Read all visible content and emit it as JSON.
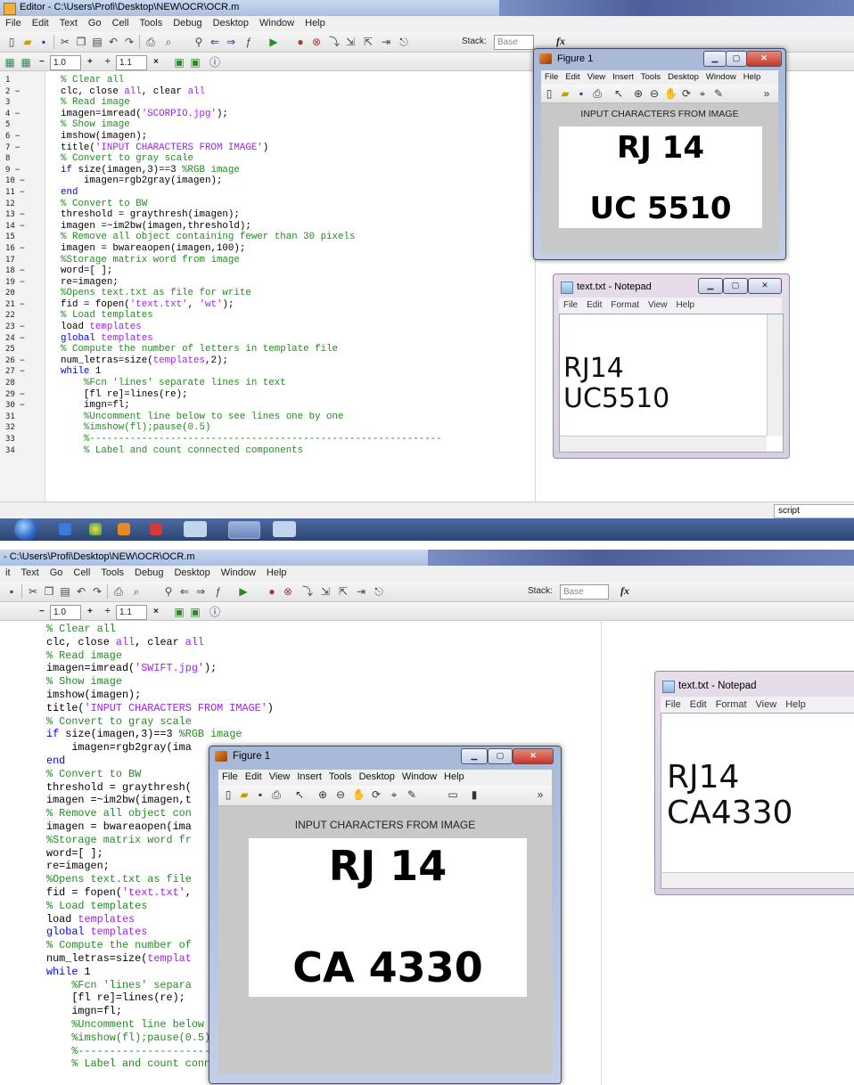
{
  "shot1": {
    "window_title": "Editor - C:\\Users\\Profi\\Desktop\\NEW\\OCR\\OCR.m",
    "menu": [
      "File",
      "Edit",
      "Text",
      "Go",
      "Cell",
      "Tools",
      "Debug",
      "Desktop",
      "Window",
      "Help"
    ],
    "toolbar": {
      "stack_label": "Stack:",
      "stack_value": "Base",
      "fx": "fx"
    },
    "cell_toolbar": {
      "minus": "−",
      "val1": "1.0",
      "plus": "+",
      "div": "÷",
      "val2": "1.1",
      "times": "×"
    },
    "line_numbers": [
      "1",
      "2 −",
      "3",
      "4 −",
      "5",
      "6 −",
      "7 −",
      "8",
      "9 −",
      "10 −",
      "11 −",
      "12",
      "13 −",
      "14 −",
      "15",
      "16 −",
      "17",
      "18 −",
      "19 −",
      "20",
      "21 −",
      "22",
      "23 −",
      "24 −",
      "25",
      "26 −",
      "27 −",
      "28",
      "29 −",
      "30 −",
      "31",
      "32",
      "33",
      "34"
    ],
    "status_script": "script",
    "figure": {
      "title": "Figure 1",
      "menu": [
        "File",
        "Edit",
        "View",
        "Insert",
        "Tools",
        "Desktop",
        "Window",
        "Help"
      ],
      "caption": "INPUT CHARACTERS FROM IMAGE",
      "plate_line1": "RJ 14",
      "plate_line2": "UC 5510"
    },
    "notepad": {
      "title": "text.txt - Notepad",
      "menu": [
        "File",
        "Edit",
        "Format",
        "View",
        "Help"
      ],
      "line1": "RJ14",
      "line2": "UC5510"
    }
  },
  "shot2": {
    "window_title": "- C:\\Users\\Profi\\Desktop\\NEW\\OCR\\OCR.m",
    "menu": [
      "it",
      "Text",
      "Go",
      "Cell",
      "Tools",
      "Debug",
      "Desktop",
      "Window",
      "Help"
    ],
    "toolbar": {
      "stack_label": "Stack:",
      "stack_value": "Base",
      "fx": "fx"
    },
    "cell_toolbar": {
      "minus": "−",
      "val1": "1.0",
      "plus": "+",
      "div": "÷",
      "val2": "1.1",
      "times": "×"
    },
    "figure": {
      "title": "Figure 1",
      "menu": [
        "File",
        "Edit",
        "View",
        "Insert",
        "Tools",
        "Desktop",
        "Window",
        "Help"
      ],
      "caption": "INPUT CHARACTERS FROM IMAGE",
      "plate_line1": "RJ 14",
      "plate_line2": "CA 4330"
    },
    "notepad": {
      "title": "text.txt - Notepad",
      "menu": [
        "File",
        "Edit",
        "Format",
        "View",
        "Help"
      ],
      "line1": "RJ14",
      "line2": "CA4330"
    }
  },
  "code_shot1": [
    [
      {
        "t": "% Clear all",
        "c": "com"
      }
    ],
    [
      {
        "t": "clc, close ",
        "c": ""
      },
      {
        "t": "all",
        "c": "str"
      },
      {
        "t": ", clear ",
        "c": ""
      },
      {
        "t": "all",
        "c": "str"
      }
    ],
    [
      {
        "t": "% Read image",
        "c": "com"
      }
    ],
    [
      {
        "t": "imagen=imread(",
        "c": ""
      },
      {
        "t": "'SCORPIO.jpg'",
        "c": "str"
      },
      {
        "t": ");",
        "c": ""
      }
    ],
    [
      {
        "t": "% Show image",
        "c": "com"
      }
    ],
    [
      {
        "t": "imshow(imagen);",
        "c": ""
      }
    ],
    [
      {
        "t": "title(",
        "c": ""
      },
      {
        "t": "'INPUT CHARACTERS FROM IMAGE'",
        "c": "str"
      },
      {
        "t": ")",
        "c": ""
      }
    ],
    [
      {
        "t": "% Convert to gray scale",
        "c": "com"
      }
    ],
    [
      {
        "t": "if",
        "c": "kw"
      },
      {
        "t": " size(imagen,3)==3 ",
        "c": ""
      },
      {
        "t": "%RGB image",
        "c": "com"
      }
    ],
    [
      {
        "t": "    imagen=rgb2gray(imagen);",
        "c": ""
      }
    ],
    [
      {
        "t": "end",
        "c": "kw"
      }
    ],
    [
      {
        "t": "% Convert to BW",
        "c": "com"
      }
    ],
    [
      {
        "t": "threshold = graythresh(imagen);",
        "c": ""
      }
    ],
    [
      {
        "t": "imagen =~im2bw(imagen,threshold);",
        "c": ""
      }
    ],
    [
      {
        "t": "% Remove all object containing fewer than 30 pixels",
        "c": "com"
      }
    ],
    [
      {
        "t": "imagen = bwareaopen(imagen,100);",
        "c": ""
      }
    ],
    [
      {
        "t": "%Storage matrix word from image",
        "c": "com"
      }
    ],
    [
      {
        "t": "word=[ ];",
        "c": ""
      }
    ],
    [
      {
        "t": "re=imagen;",
        "c": ""
      }
    ],
    [
      {
        "t": "%Opens text.txt as file for write",
        "c": "com"
      }
    ],
    [
      {
        "t": "fid = fopen(",
        "c": ""
      },
      {
        "t": "'text.txt'",
        "c": "str"
      },
      {
        "t": ", ",
        "c": ""
      },
      {
        "t": "'wt'",
        "c": "str"
      },
      {
        "t": ");",
        "c": ""
      }
    ],
    [
      {
        "t": "% Load templates",
        "c": "com"
      }
    ],
    [
      {
        "t": "load ",
        "c": ""
      },
      {
        "t": "templates",
        "c": "str"
      }
    ],
    [
      {
        "t": "global",
        "c": "kw"
      },
      {
        "t": " templates",
        "c": "str"
      }
    ],
    [
      {
        "t": "% Compute the number of letters in template file",
        "c": "com"
      }
    ],
    [
      {
        "t": "num_letras=size(",
        "c": ""
      },
      {
        "t": "templates",
        "c": "str"
      },
      {
        "t": ",2);",
        "c": ""
      }
    ],
    [
      {
        "t": "while",
        "c": "kw"
      },
      {
        "t": " 1",
        "c": ""
      }
    ],
    [
      {
        "t": "    %Fcn 'lines' separate lines in text",
        "c": "com"
      }
    ],
    [
      {
        "t": "    [fl re]=lines(re);",
        "c": ""
      }
    ],
    [
      {
        "t": "    imgn=fl;",
        "c": ""
      }
    ],
    [
      {
        "t": "    %Uncomment line below to see lines one by one",
        "c": "com"
      }
    ],
    [
      {
        "t": "    %imshow(fl);pause(0.5)",
        "c": "com"
      }
    ],
    [
      {
        "t": "    %-------------------------------------------------------------",
        "c": "com"
      }
    ],
    [
      {
        "t": "    % Label and count connected components",
        "c": "com"
      }
    ]
  ],
  "code_shot2": [
    [
      {
        "t": "% Clear all",
        "c": "com"
      }
    ],
    [
      {
        "t": "clc, close ",
        "c": ""
      },
      {
        "t": "all",
        "c": "str"
      },
      {
        "t": ", clear ",
        "c": ""
      },
      {
        "t": "all",
        "c": "str"
      }
    ],
    [
      {
        "t": "% Read image",
        "c": "com"
      }
    ],
    [
      {
        "t": "imagen=imread(",
        "c": ""
      },
      {
        "t": "'SWIFT.jpg'",
        "c": "str"
      },
      {
        "t": ");",
        "c": ""
      }
    ],
    [
      {
        "t": "% Show image",
        "c": "com"
      }
    ],
    [
      {
        "t": "imshow(imagen);",
        "c": ""
      }
    ],
    [
      {
        "t": "title(",
        "c": ""
      },
      {
        "t": "'INPUT CHARACTERS FROM IMAGE'",
        "c": "str"
      },
      {
        "t": ")",
        "c": ""
      }
    ],
    [
      {
        "t": "% Convert to gray scale",
        "c": "com"
      }
    ],
    [
      {
        "t": "if",
        "c": "kw"
      },
      {
        "t": " size(imagen,3)==3 ",
        "c": ""
      },
      {
        "t": "%RGB image",
        "c": "com"
      }
    ],
    [
      {
        "t": "    imagen=rgb2gray(ima",
        "c": ""
      }
    ],
    [
      {
        "t": "end",
        "c": "kw"
      }
    ],
    [
      {
        "t": "% Convert to BW",
        "c": "com"
      }
    ],
    [
      {
        "t": "threshold = graythresh(",
        "c": ""
      }
    ],
    [
      {
        "t": "imagen =~im2bw(imagen,t",
        "c": ""
      }
    ],
    [
      {
        "t": "% Remove all object con",
        "c": "com"
      }
    ],
    [
      {
        "t": "imagen = bwareaopen(ima",
        "c": ""
      }
    ],
    [
      {
        "t": "%Storage matrix word fr",
        "c": "com"
      }
    ],
    [
      {
        "t": "word=[ ];",
        "c": ""
      }
    ],
    [
      {
        "t": "re=imagen;",
        "c": ""
      }
    ],
    [
      {
        "t": "%Opens text.txt as file",
        "c": "com"
      }
    ],
    [
      {
        "t": "fid = fopen(",
        "c": ""
      },
      {
        "t": "'text.txt'",
        "c": "str"
      },
      {
        "t": ",",
        "c": ""
      }
    ],
    [
      {
        "t": "% Load templates",
        "c": "com"
      }
    ],
    [
      {
        "t": "load ",
        "c": ""
      },
      {
        "t": "templates",
        "c": "str"
      }
    ],
    [
      {
        "t": "global",
        "c": "kw"
      },
      {
        "t": " templates",
        "c": "str"
      }
    ],
    [
      {
        "t": "% Compute the number of",
        "c": "com"
      }
    ],
    [
      {
        "t": "num_letras=size(",
        "c": ""
      },
      {
        "t": "templat",
        "c": "str"
      }
    ],
    [
      {
        "t": "while",
        "c": "kw"
      },
      {
        "t": " 1",
        "c": ""
      }
    ],
    [
      {
        "t": "    %Fcn 'lines' separa",
        "c": "com"
      }
    ],
    [
      {
        "t": "    [fl re]=lines(re);",
        "c": ""
      }
    ],
    [
      {
        "t": "    imgn=fl;",
        "c": ""
      }
    ],
    [
      {
        "t": "    %Uncomment line below to see lines one by one",
        "c": "com"
      }
    ],
    [
      {
        "t": "    %imshow(fl);pause(0.5)",
        "c": "com"
      }
    ],
    [
      {
        "t": "    %-------------------------------------------------------------",
        "c": "com"
      }
    ],
    [
      {
        "t": "    % Label and count connected components",
        "c": "com"
      }
    ]
  ]
}
